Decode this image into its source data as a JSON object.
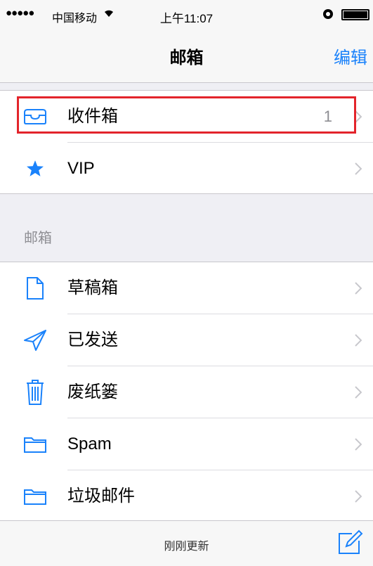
{
  "status_bar": {
    "signal": "●●●●●",
    "carrier": "中国移动",
    "time": "上午11:07"
  },
  "nav": {
    "title": "邮箱",
    "edit_label": "编辑"
  },
  "favorites": [
    {
      "label": "收件箱",
      "count": "1",
      "icon": "inbox-tray-icon"
    },
    {
      "label": "VIP",
      "count": "",
      "icon": "star-icon"
    }
  ],
  "mailboxes": {
    "header": "邮箱",
    "items": [
      {
        "label": "草稿箱",
        "icon": "document-icon"
      },
      {
        "label": "已发送",
        "icon": "paper-plane-icon"
      },
      {
        "label": "废纸篓",
        "icon": "trash-icon"
      },
      {
        "label": "Spam",
        "icon": "folder-icon"
      },
      {
        "label": "垃圾邮件",
        "icon": "folder-icon"
      }
    ]
  },
  "toolbar": {
    "status": "刚刚更新"
  },
  "colors": {
    "accent": "#1a82fb",
    "highlight": "#e3242b",
    "background": "#efeff4"
  }
}
